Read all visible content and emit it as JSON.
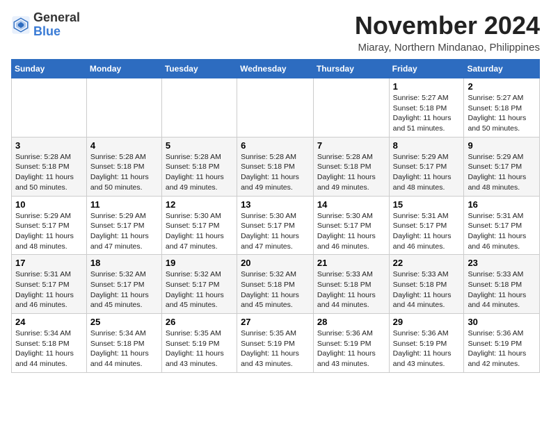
{
  "header": {
    "logo_general": "General",
    "logo_blue": "Blue",
    "month_title": "November 2024",
    "location": "Miaray, Northern Mindanao, Philippines"
  },
  "weekdays": [
    "Sunday",
    "Monday",
    "Tuesday",
    "Wednesday",
    "Thursday",
    "Friday",
    "Saturday"
  ],
  "weeks": [
    [
      {
        "day": "",
        "info": ""
      },
      {
        "day": "",
        "info": ""
      },
      {
        "day": "",
        "info": ""
      },
      {
        "day": "",
        "info": ""
      },
      {
        "day": "",
        "info": ""
      },
      {
        "day": "1",
        "info": "Sunrise: 5:27 AM\nSunset: 5:18 PM\nDaylight: 11 hours and 51 minutes."
      },
      {
        "day": "2",
        "info": "Sunrise: 5:27 AM\nSunset: 5:18 PM\nDaylight: 11 hours and 50 minutes."
      }
    ],
    [
      {
        "day": "3",
        "info": "Sunrise: 5:28 AM\nSunset: 5:18 PM\nDaylight: 11 hours and 50 minutes."
      },
      {
        "day": "4",
        "info": "Sunrise: 5:28 AM\nSunset: 5:18 PM\nDaylight: 11 hours and 50 minutes."
      },
      {
        "day": "5",
        "info": "Sunrise: 5:28 AM\nSunset: 5:18 PM\nDaylight: 11 hours and 49 minutes."
      },
      {
        "day": "6",
        "info": "Sunrise: 5:28 AM\nSunset: 5:18 PM\nDaylight: 11 hours and 49 minutes."
      },
      {
        "day": "7",
        "info": "Sunrise: 5:28 AM\nSunset: 5:18 PM\nDaylight: 11 hours and 49 minutes."
      },
      {
        "day": "8",
        "info": "Sunrise: 5:29 AM\nSunset: 5:17 PM\nDaylight: 11 hours and 48 minutes."
      },
      {
        "day": "9",
        "info": "Sunrise: 5:29 AM\nSunset: 5:17 PM\nDaylight: 11 hours and 48 minutes."
      }
    ],
    [
      {
        "day": "10",
        "info": "Sunrise: 5:29 AM\nSunset: 5:17 PM\nDaylight: 11 hours and 48 minutes."
      },
      {
        "day": "11",
        "info": "Sunrise: 5:29 AM\nSunset: 5:17 PM\nDaylight: 11 hours and 47 minutes."
      },
      {
        "day": "12",
        "info": "Sunrise: 5:30 AM\nSunset: 5:17 PM\nDaylight: 11 hours and 47 minutes."
      },
      {
        "day": "13",
        "info": "Sunrise: 5:30 AM\nSunset: 5:17 PM\nDaylight: 11 hours and 47 minutes."
      },
      {
        "day": "14",
        "info": "Sunrise: 5:30 AM\nSunset: 5:17 PM\nDaylight: 11 hours and 46 minutes."
      },
      {
        "day": "15",
        "info": "Sunrise: 5:31 AM\nSunset: 5:17 PM\nDaylight: 11 hours and 46 minutes."
      },
      {
        "day": "16",
        "info": "Sunrise: 5:31 AM\nSunset: 5:17 PM\nDaylight: 11 hours and 46 minutes."
      }
    ],
    [
      {
        "day": "17",
        "info": "Sunrise: 5:31 AM\nSunset: 5:17 PM\nDaylight: 11 hours and 46 minutes."
      },
      {
        "day": "18",
        "info": "Sunrise: 5:32 AM\nSunset: 5:17 PM\nDaylight: 11 hours and 45 minutes."
      },
      {
        "day": "19",
        "info": "Sunrise: 5:32 AM\nSunset: 5:17 PM\nDaylight: 11 hours and 45 minutes."
      },
      {
        "day": "20",
        "info": "Sunrise: 5:32 AM\nSunset: 5:18 PM\nDaylight: 11 hours and 45 minutes."
      },
      {
        "day": "21",
        "info": "Sunrise: 5:33 AM\nSunset: 5:18 PM\nDaylight: 11 hours and 44 minutes."
      },
      {
        "day": "22",
        "info": "Sunrise: 5:33 AM\nSunset: 5:18 PM\nDaylight: 11 hours and 44 minutes."
      },
      {
        "day": "23",
        "info": "Sunrise: 5:33 AM\nSunset: 5:18 PM\nDaylight: 11 hours and 44 minutes."
      }
    ],
    [
      {
        "day": "24",
        "info": "Sunrise: 5:34 AM\nSunset: 5:18 PM\nDaylight: 11 hours and 44 minutes."
      },
      {
        "day": "25",
        "info": "Sunrise: 5:34 AM\nSunset: 5:18 PM\nDaylight: 11 hours and 44 minutes."
      },
      {
        "day": "26",
        "info": "Sunrise: 5:35 AM\nSunset: 5:19 PM\nDaylight: 11 hours and 43 minutes."
      },
      {
        "day": "27",
        "info": "Sunrise: 5:35 AM\nSunset: 5:19 PM\nDaylight: 11 hours and 43 minutes."
      },
      {
        "day": "28",
        "info": "Sunrise: 5:36 AM\nSunset: 5:19 PM\nDaylight: 11 hours and 43 minutes."
      },
      {
        "day": "29",
        "info": "Sunrise: 5:36 AM\nSunset: 5:19 PM\nDaylight: 11 hours and 43 minutes."
      },
      {
        "day": "30",
        "info": "Sunrise: 5:36 AM\nSunset: 5:19 PM\nDaylight: 11 hours and 42 minutes."
      }
    ]
  ]
}
